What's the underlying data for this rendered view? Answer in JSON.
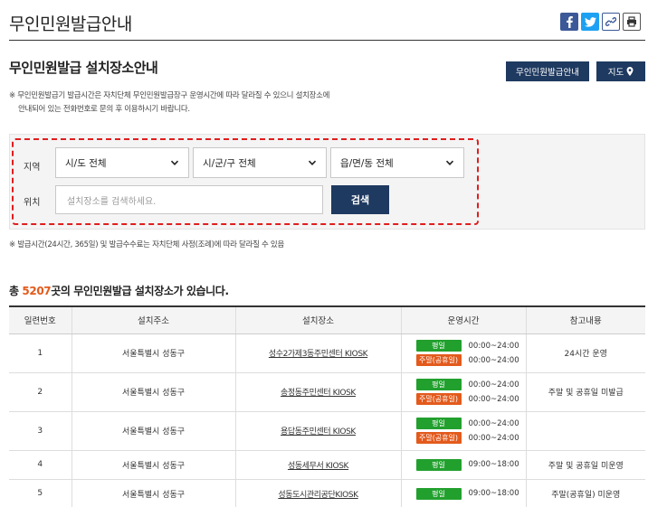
{
  "page": {
    "title": "무인민원발급안내",
    "share_icons": [
      "facebook-icon",
      "twitter-icon",
      "link-icon",
      "print-icon"
    ]
  },
  "section": {
    "title": "무인민원발급 설치장소안내",
    "info_button": "무인민원발급안내",
    "map_button": "지도",
    "notice_line1": "※ 무인민원발급기 발급시간은 자치단체 무인민원발급장구 운영시간에 따라 달라질 수 있으니 설치장소에",
    "notice_line2": "안내되어 있는 전화번호로 문의 후 이용하시기 바랍니다."
  },
  "search": {
    "region_label": "지역",
    "location_label": "위치",
    "select1": "시/도 전체",
    "select2": "시/군/구 전체",
    "select3": "읍/면/동 전체",
    "placeholder": "설치장소를 검색하세요.",
    "button": "검색"
  },
  "footnote": "※ 발급시간(24시간, 365일) 및 발급수수료는 자치단체 사정(조례)에 따라 달라질 수 있음",
  "summary": {
    "prefix": "총 ",
    "count": "5207",
    "suffix": "곳의 무인민원발급 설치장소가 있습니다."
  },
  "table": {
    "headers": [
      "일련번호",
      "설치주소",
      "설치장소",
      "운영시간",
      "참고내용"
    ],
    "weekday_label": "평일",
    "weekend_label": "주말(공휴일)",
    "rows": [
      {
        "no": "1",
        "address": "서울특별시 성동구",
        "place": "성수2가제3동주민센터 KIOSK",
        "weekday": "00:00~24:00",
        "weekend": "00:00~24:00",
        "note": "24시간 운영"
      },
      {
        "no": "2",
        "address": "서울특별시 성동구",
        "place": "송정동주민센터 KIOSK",
        "weekday": "00:00~24:00",
        "weekend": "00:00~24:00",
        "note": "주말 및 공휴일 미발급"
      },
      {
        "no": "3",
        "address": "서울특별시 성동구",
        "place": "용답동주민센터 KIOSK",
        "weekday": "00:00~24:00",
        "weekend": "00:00~24:00",
        "note": ""
      },
      {
        "no": "4",
        "address": "서울특별시 성동구",
        "place": "성동세무서 KIOSK",
        "weekday": "09:00~18:00",
        "note": "주말 및 공휴일 미운영"
      },
      {
        "no": "5",
        "address": "서울특별시 성동구",
        "place": "성동도시관리공단KIOSK",
        "weekday": "09:00~18:00",
        "note": "주말(공휴일) 미운영"
      }
    ]
  },
  "colors": {
    "navy": "#1f3a60",
    "accent": "#e35a1c",
    "weekday_badge": "#22a02e",
    "weekend_badge": "#e35a1c",
    "highlight_border": "#e01e1e"
  }
}
